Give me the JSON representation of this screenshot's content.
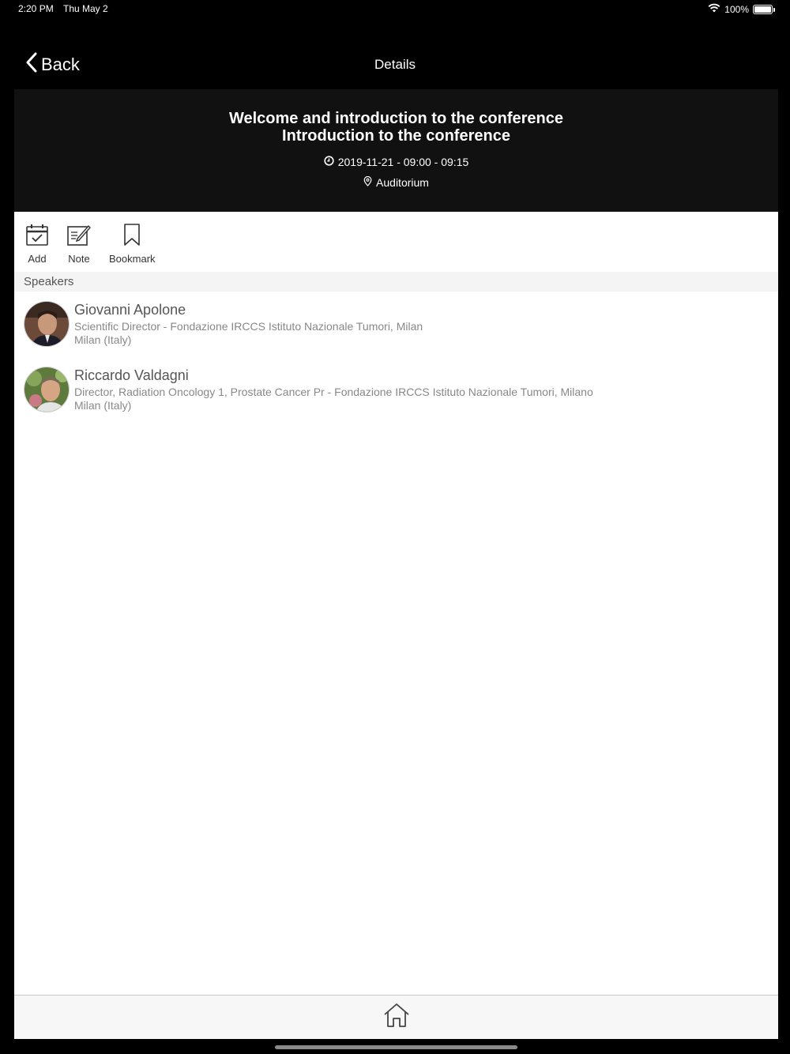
{
  "status": {
    "time": "2:20 PM",
    "date": "Thu May 2",
    "battery": "100%"
  },
  "nav": {
    "back_label": "Back",
    "title": "Details"
  },
  "session": {
    "title_line1": "Welcome and introduction to the conference",
    "title_line2": "Introduction to the conference",
    "datetime": "2019-11-21 - 09:00 - 09:15",
    "location": "Auditorium"
  },
  "actions": {
    "add_label": "Add",
    "note_label": "Note",
    "bookmark_label": "Bookmark"
  },
  "speakers": {
    "section_title": "Speakers",
    "items": [
      {
        "name": "Giovanni Apolone",
        "role": "Scientific Director - Fondazione IRCCS Istituto Nazionale Tumori, Milan",
        "location": "Milan (Italy)"
      },
      {
        "name": "Riccardo Valdagni",
        "role": "Director, Radiation Oncology 1, Prostate Cancer Pr - Fondazione IRCCS Istituto Nazionale Tumori, Milano",
        "location": "Milan (Italy)"
      }
    ]
  },
  "colors": {
    "background": "#000000",
    "header_bg": "#111111",
    "content_bg": "#ffffff",
    "section_bg": "#f4f4f4"
  }
}
